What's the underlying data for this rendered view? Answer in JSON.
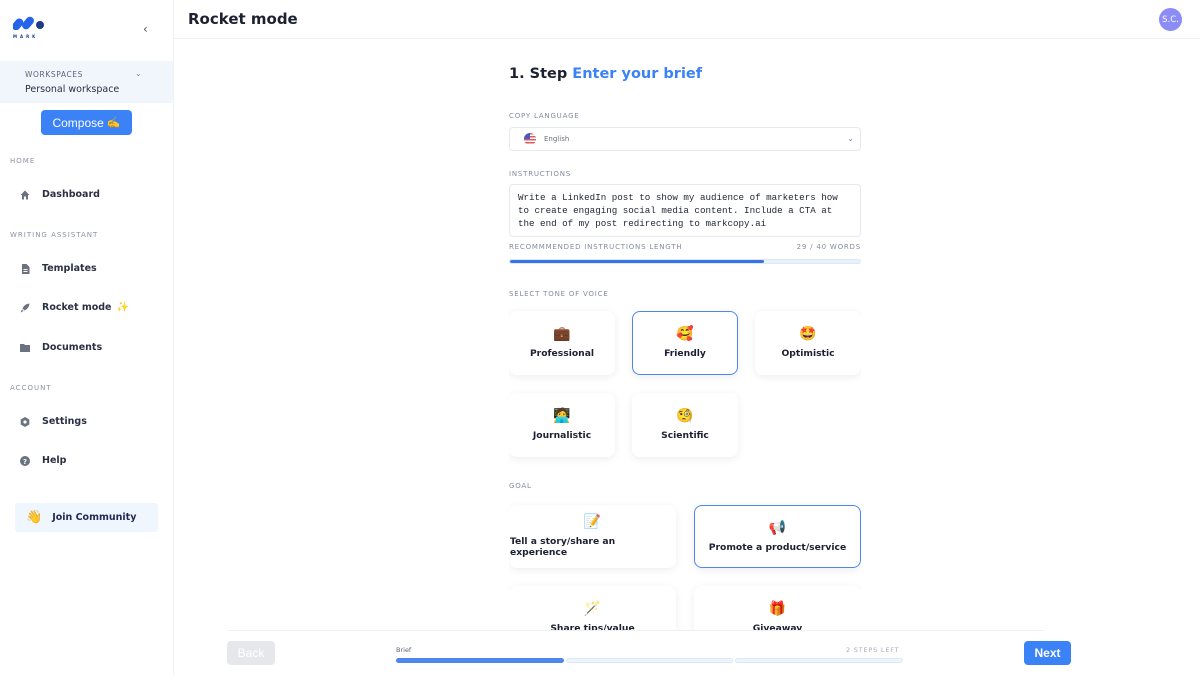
{
  "sidebar": {
    "logo_text": "MARK",
    "collapse_icon": "chevron-left-icon",
    "workspace": {
      "label": "WORKSPACES",
      "name": "Personal workspace"
    },
    "compose_label": "Compose",
    "compose_emoji": "✍️",
    "sections": {
      "home": "HOME",
      "writing": "WRITING ASSISTANT",
      "account": "ACCOUNT"
    },
    "items": [
      {
        "label": "Dashboard",
        "icon": "home-icon"
      },
      {
        "label": "Templates",
        "icon": "document-icon"
      },
      {
        "label": "Rocket mode",
        "icon": "rocket-icon",
        "suffix": "✨"
      },
      {
        "label": "Documents",
        "icon": "folder-icon"
      },
      {
        "label": "Settings",
        "icon": "gear-icon"
      },
      {
        "label": "Help",
        "icon": "help-icon"
      }
    ],
    "community": {
      "label": "Join Community",
      "emoji": "👋"
    }
  },
  "header": {
    "title": "Rocket mode",
    "avatar_initials": "S.C."
  },
  "brief": {
    "step_prefix": "1. Step",
    "step_title": "Enter your brief",
    "language_label": "COPY LANGUAGE",
    "language_value": "English",
    "instructions_label": "INSTRUCTIONS",
    "instructions_value": "Write a LinkedIn post to show my audience of marketers how to create engaging social media content. Include a CTA at the end of my post redirecting to markcopy.ai",
    "recommended_label": "RECOMMMENDED INSTRUCTIONS LENGTH",
    "word_count": "29 / 40 WORDS",
    "word_progress": 0.725,
    "tone_label": "SELECT TONE OF VOICE",
    "tones": [
      {
        "label": "Professional",
        "emoji": "💼",
        "selected": false
      },
      {
        "label": "Friendly",
        "emoji": "🥰",
        "selected": true
      },
      {
        "label": "Optimistic",
        "emoji": "🤩",
        "selected": false
      },
      {
        "label": "Journalistic",
        "emoji": "🧑‍💻",
        "selected": false
      },
      {
        "label": "Scientific",
        "emoji": "🧐",
        "selected": false
      }
    ],
    "goal_label": "GOAL",
    "goals": [
      {
        "label": "Tell a story/share an experience",
        "emoji": "📝",
        "selected": false
      },
      {
        "label": "Promote a product/service",
        "emoji": "📢",
        "selected": true
      },
      {
        "label": "Share tips/value",
        "emoji": "🪄",
        "selected": false
      },
      {
        "label": "Giveaway",
        "emoji": "🎁",
        "selected": false
      }
    ]
  },
  "footer": {
    "back_label": "Back",
    "next_label": "Next",
    "current_step": "Brief",
    "steps_left": "2 STEPS LEFT",
    "total_steps": 3,
    "completed_steps": 1
  },
  "colors": {
    "accent": "#3b82f6",
    "avatar": "#8b8cf6",
    "selected_border": "#4f86ee"
  }
}
